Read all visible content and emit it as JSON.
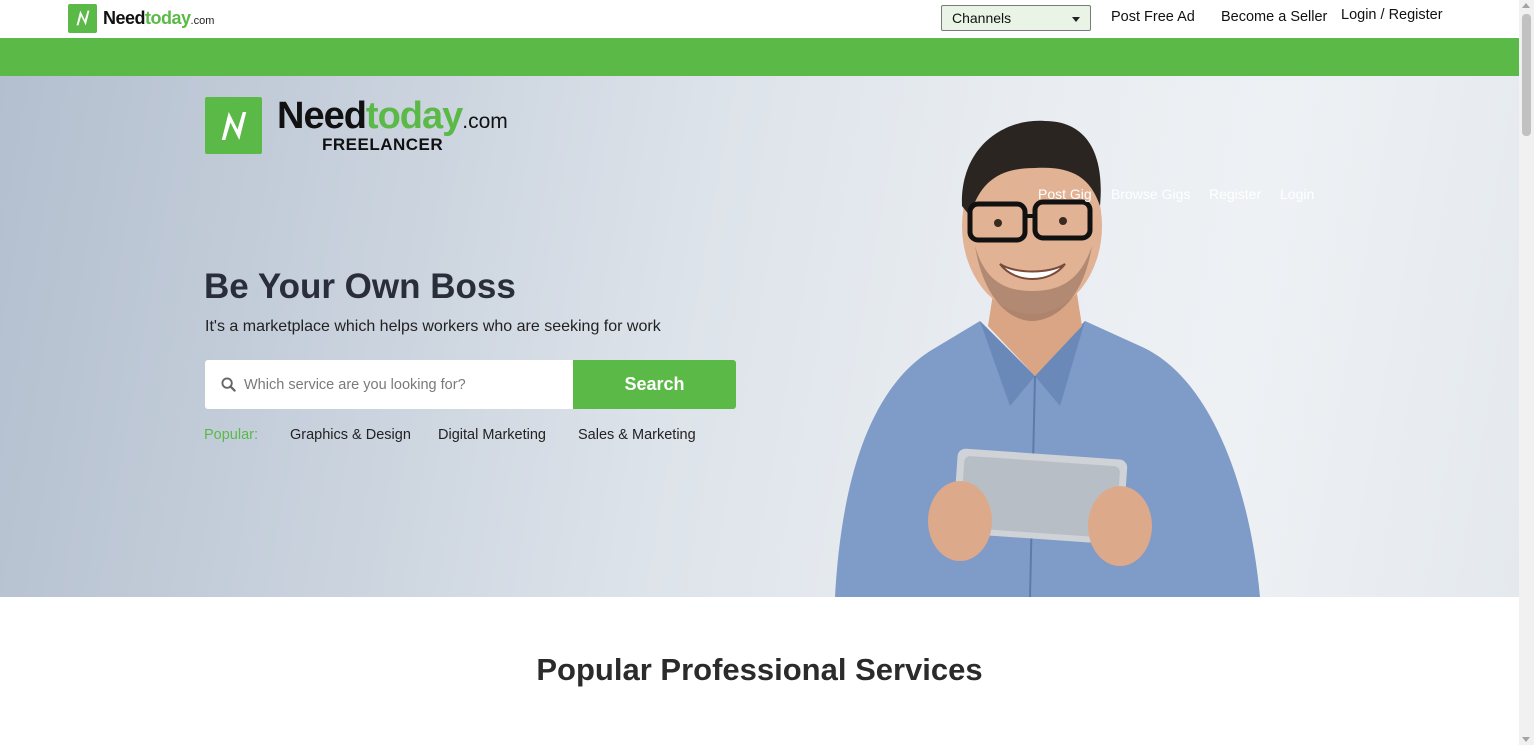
{
  "top_nav": {
    "logo": {
      "word1": "Need",
      "word2": "today",
      "suffix": ".com"
    },
    "channels_select": {
      "selected": "Channels"
    },
    "post_free_ad": "Post Free Ad",
    "become_seller": "Become a Seller",
    "login_register": "Login / Register"
  },
  "hero": {
    "logo": {
      "word1": "Need",
      "word2": "today",
      "suffix": ".com",
      "subtitle": "FREELANCER"
    },
    "nav": [
      "Post Gig",
      "Browse Gigs",
      "Register",
      "Login"
    ],
    "title": "Be Your Own Boss",
    "subtitle": "It's a marketplace which helps workers who are seeking for work",
    "search": {
      "placeholder": "Which service are you looking for?",
      "button_label": "Search"
    },
    "popular": {
      "label": "Popular:",
      "items": [
        "Graphics & Design",
        "Digital Marketing",
        "Sales & Marketing"
      ]
    }
  },
  "section": {
    "title": "Popular Professional Services"
  },
  "colors": {
    "brand_green": "#5bb947",
    "text_dark": "#2a2d3a"
  },
  "icons": {
    "logo": "lightning-n-logo-icon",
    "search": "search-icon",
    "dropdown": "caret-down-icon"
  }
}
